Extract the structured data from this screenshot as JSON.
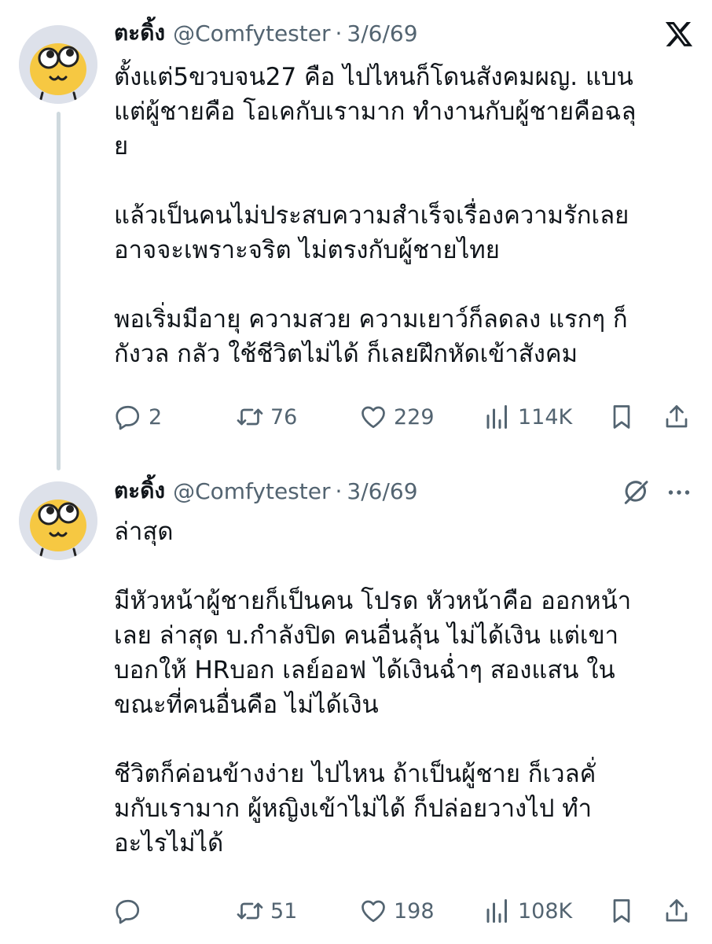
{
  "tweets": [
    {
      "name": "ตะดิ้ง",
      "handle": "@Comfytester",
      "separator": "·",
      "date": "3/6/69",
      "lines": [
        "ตั้งแต่5ขวบจน27 คือ ไปไหนก็โดนสังคมผญ. แบน",
        "แต่ผู้ชายคือ โอเคกับเรามาก ทำงานกับผู้ชายคือฉลุ",
        "ย",
        "",
        "แล้วเป็นคนไม่ประสบความสำเร็จเรื่องความรักเลย",
        "อาจจะเพราะจริต ไม่ตรงกับผู้ชายไทย",
        "",
        "พอเริ่มมีอายุ ความสวย ความเยาว์ก็ลดลง แรกๆ ก็",
        "กังวล กลัว ใช้ชีวิตไม่ได้ ก็เลยฝึกหัดเข้าสังคม"
      ],
      "replies": "2",
      "reposts": "76",
      "likes": "229",
      "views": "114K",
      "top_icon": "x-logo-icon"
    },
    {
      "name": "ตะดิ้ง",
      "handle": "@Comfytester",
      "separator": "·",
      "date": "3/6/69",
      "lines": [
        "ล่าสุด",
        "",
        "มีหัวหน้าผู้ชายก็เป็นคน โปรด หัวหน้าคือ ออกหน้า",
        "เลย ล่าสุด บ.กำลังปิด คนอื่นลุ้น ไม่ได้เงิน แต่เขา",
        "บอกให้ HRบอก เลย์ออฟ ได้เงินฉ่ำๆ สองแสน ใน",
        "ขณะที่คนอื่นคือ ไม่ได้เงิน",
        "",
        "ชีวิตก็ค่อนข้างง่าย ไปไหน ถ้าเป็นผู้ชาย ก็เวลคั่",
        "มกับเรามาก ผู้หญิงเข้าไม่ได้ ก็ปล่อยวางไป ทำ",
        "อะไรไม่ได้"
      ],
      "replies": "",
      "reposts": "51",
      "likes": "198",
      "views": "108K",
      "top_icon": "grok-icon"
    }
  ],
  "colors": {
    "text": "#0f1419",
    "secondary": "#536471",
    "thread_line": "#cfd9de",
    "avatar_bg": "#dde1ea",
    "avatar_face": "#f6c842"
  }
}
